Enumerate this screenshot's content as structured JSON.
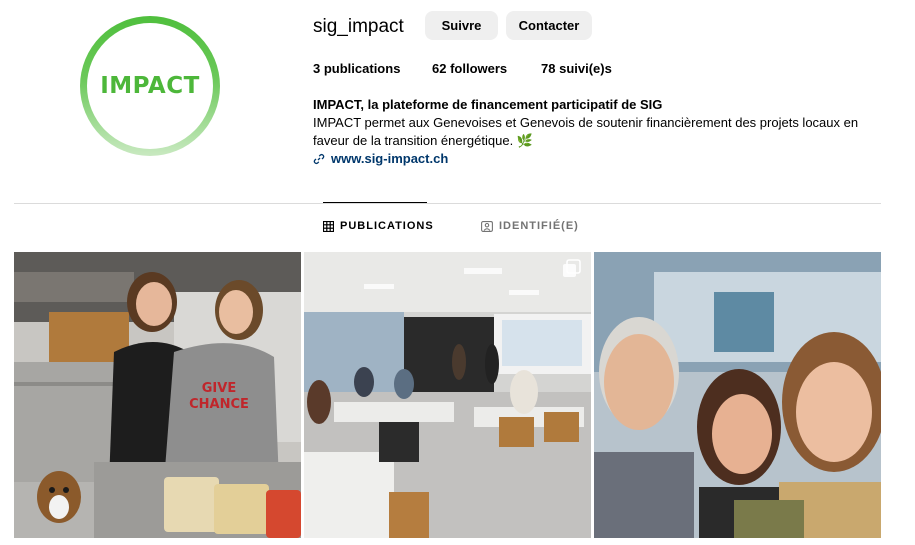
{
  "profile": {
    "username": "sig_impact",
    "logo_text": "IMPACT",
    "follow_label": "Suivre",
    "contact_label": "Contacter",
    "stats": {
      "posts_count": "3",
      "posts_label": "publications",
      "followers_count": "62",
      "followers_label": "followers",
      "following_count": "78",
      "following_label": "suivi(e)s"
    },
    "bio": {
      "name": "IMPACT, la plateforme de financement participatif de SIG",
      "text": "IMPACT permet aux Genevoises et Genevois de soutenir financièrement des projets locaux en faveur de la transition énergétique.",
      "emoji": "🌿",
      "link": "www.sig-impact.ch"
    }
  },
  "tabs": {
    "publications": "PUBLICATIONS",
    "tagged": "IDENTIFIÉ(E)"
  },
  "posts": {
    "post1": {
      "shirt_text": "GIVE CHANCE"
    }
  },
  "colors": {
    "brand_green": "#4db73a",
    "button_bg": "#efefef",
    "link": "#00376b"
  }
}
